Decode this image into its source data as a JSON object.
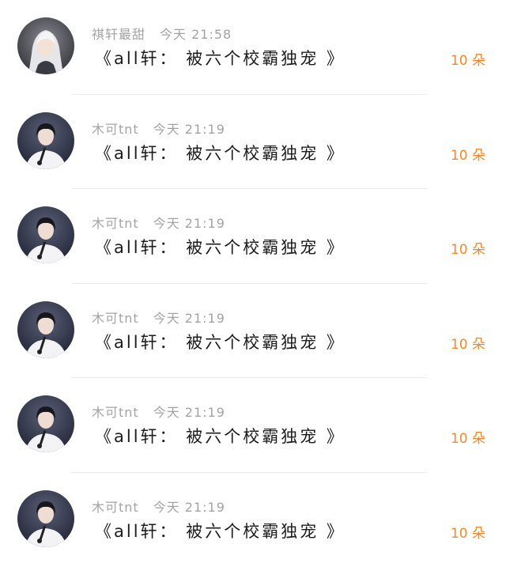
{
  "messages": [
    {
      "sender": "祺轩最甜",
      "time": "今天 21:58",
      "title": "《all轩： 被六个校霸独宠 》",
      "reward": "10 朵",
      "avatar_icon": "white-hair-portrait-avatar"
    },
    {
      "sender": "木可tnt",
      "time": "今天 21:19",
      "title": "《all轩： 被六个校霸独宠 》",
      "reward": "10 朵",
      "avatar_icon": "singer-portrait-avatar"
    },
    {
      "sender": "木可tnt",
      "time": "今天 21:19",
      "title": "《all轩： 被六个校霸独宠 》",
      "reward": "10 朵",
      "avatar_icon": "singer-portrait-avatar"
    },
    {
      "sender": "木可tnt",
      "time": "今天 21:19",
      "title": "《all轩： 被六个校霸独宠 》",
      "reward": "10 朵",
      "avatar_icon": "singer-portrait-avatar"
    },
    {
      "sender": "木可tnt",
      "time": "今天 21:19",
      "title": "《all轩： 被六个校霸独宠 》",
      "reward": "10 朵",
      "avatar_icon": "singer-portrait-avatar"
    },
    {
      "sender": "木可tnt",
      "time": "今天 21:19",
      "title": "《all轩： 被六个校霸独宠 》",
      "reward": "10 朵",
      "avatar_icon": "singer-portrait-avatar"
    }
  ],
  "colors": {
    "sender_text": "#a3a3a3",
    "title_text": "#1c1c1c",
    "reward_accent": "#f0882d",
    "divider": "#ececec"
  }
}
